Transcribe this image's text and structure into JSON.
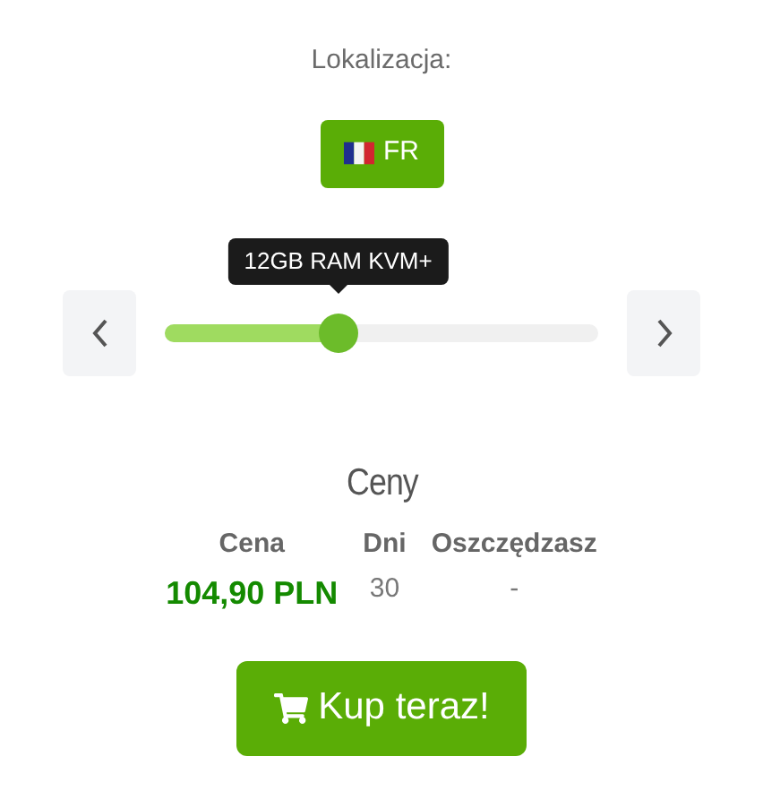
{
  "location": {
    "label": "Lokalizacja:",
    "button": "FR"
  },
  "slider": {
    "tooltip": "12GB RAM KVM+",
    "level": 0.4
  },
  "prices": {
    "title": "Ceny",
    "columns": [
      "Cena",
      "Dni",
      "Oszczędzasz"
    ],
    "rows": [
      {
        "cells": [
          "104,90 PLN",
          "30",
          "-"
        ]
      }
    ]
  },
  "buy_button": "Kup teraz!"
}
